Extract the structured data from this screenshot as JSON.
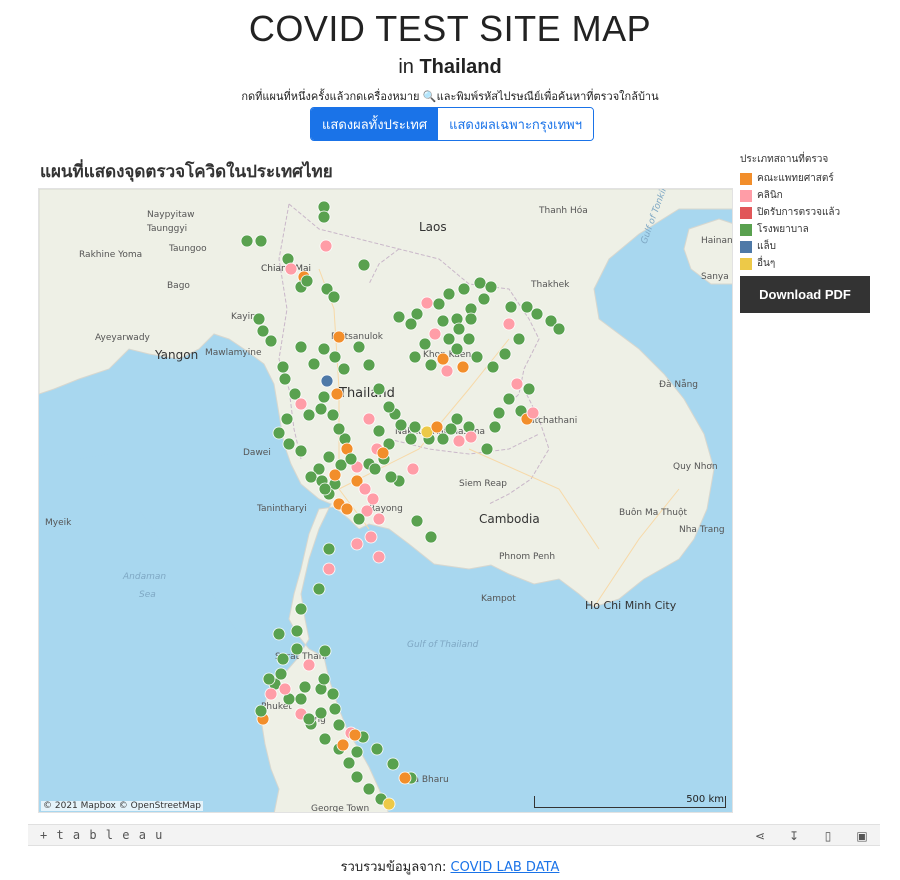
{
  "header": {
    "title": "COVID TEST SITE MAP",
    "subtitle_prefix": "in",
    "subtitle_country": "Thailand",
    "instruction": "กดที่แผนที่หนึ่งครั้งแล้วกดเครื่องหมาย 🔍และพิมพ์รหัสไปรษณีย์เพื่อค้นหาที่ตรวจใกล้บ้าน"
  },
  "toggle": {
    "active_label": "แสดงผลทั้งประเทศ",
    "inactive_label": "แสดงผลเฉพาะกรุงเทพฯ"
  },
  "viz": {
    "map_title": "แผนที่แสดงจุดตรวจโควิดในประเทศไทย",
    "attribution": "© 2021 Mapbox  © OpenStreetMap",
    "scale_label": "500 km",
    "download_label": "Download PDF"
  },
  "legend": {
    "title": "ประเภทสถานที่ตรวจ",
    "items": [
      {
        "label": "คณะแพทยศาสตร์",
        "color": "#f28e2b"
      },
      {
        "label": "คลินิก",
        "color": "#ff9da7"
      },
      {
        "label": "ปิดรับการตรวจแล้ว",
        "color": "#e15759"
      },
      {
        "label": "โรงพยาบาล",
        "color": "#59a14f"
      },
      {
        "label": "แล็บ",
        "color": "#4e79a7"
      },
      {
        "label": "อื่นๆ",
        "color": "#edc948"
      }
    ]
  },
  "places": [
    {
      "name": "Naypyitaw"
    },
    {
      "name": "Taunggyi"
    },
    {
      "name": "Rakhine Yoma"
    },
    {
      "name": "Taungoo"
    },
    {
      "name": "Bago"
    },
    {
      "name": "Kayin"
    },
    {
      "name": "Ayeyarwady"
    },
    {
      "name": "Yangon"
    },
    {
      "name": "Mawlamyine"
    },
    {
      "name": "Dawei"
    },
    {
      "name": "Tanintharyi"
    },
    {
      "name": "Myeik"
    },
    {
      "name": "Andaman"
    },
    {
      "name": "Sea"
    },
    {
      "name": "Chiang Mai"
    },
    {
      "name": "Phitsanulok"
    },
    {
      "name": "Thailand"
    },
    {
      "name": "Nakhon Ratchasima"
    },
    {
      "name": "Khon Kaen"
    },
    {
      "name": "Laos"
    },
    {
      "name": "Thanh Hóa"
    },
    {
      "name": "Hainan"
    },
    {
      "name": "Sanya"
    },
    {
      "name": "Thakhek"
    },
    {
      "name": "Ratchathani"
    },
    {
      "name": "Đà Nẵng"
    },
    {
      "name": "Quy Nhơn"
    },
    {
      "name": "Siem Reap"
    },
    {
      "name": "Cambodia"
    },
    {
      "name": "Buôn Ma Thuột"
    },
    {
      "name": "Nha Trang"
    },
    {
      "name": "Phnom Penh"
    },
    {
      "name": "Kampot"
    },
    {
      "name": "Ho Chi Minh City"
    },
    {
      "name": "Gulf of Thailand"
    },
    {
      "name": "Surat Thani"
    },
    {
      "name": "Phuket"
    },
    {
      "name": "Trang"
    },
    {
      "name": "Kota Bharu"
    },
    {
      "name": "George Town"
    },
    {
      "name": "Gulf of Tonkin"
    },
    {
      "name": "Rayong"
    }
  ],
  "footer": {
    "prefix": "รวบรวมข้อมูลจาก:",
    "link_text": "COVID LAB DATA"
  },
  "toolbar": {
    "logo": "+ t a b l e a u"
  }
}
